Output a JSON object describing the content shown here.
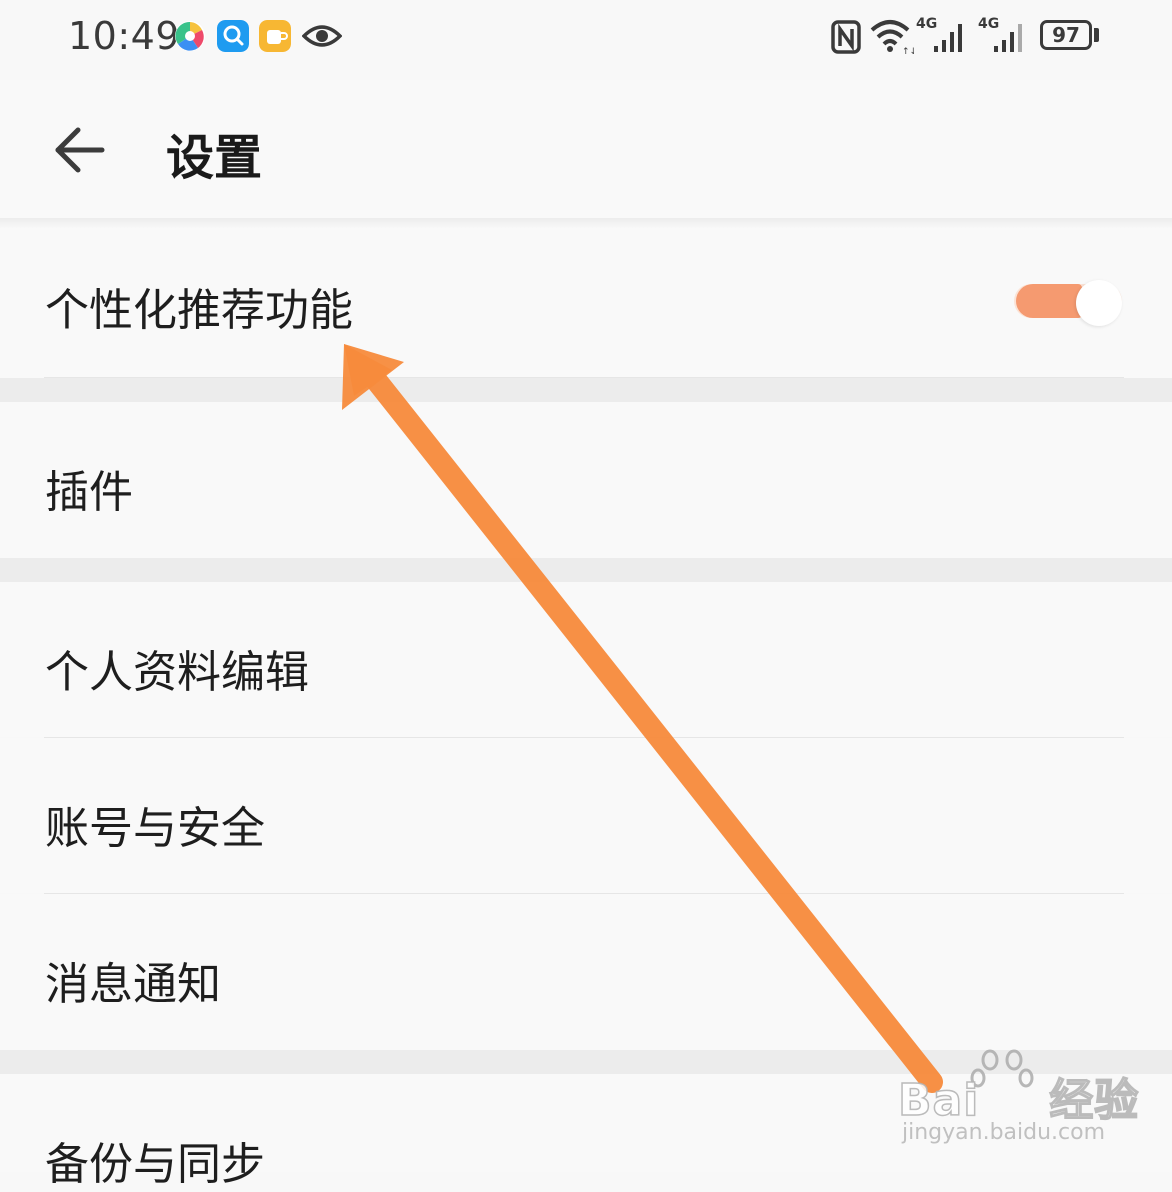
{
  "status_bar": {
    "time": "10:49",
    "left_icons": [
      "pinwheel-app-icon",
      "search-app-icon",
      "cup-app-icon",
      "eye-icon"
    ],
    "right_icons": [
      "nfc-icon",
      "wifi-icon",
      "signal-4g-icon",
      "signal-4g-icon"
    ],
    "network_1": "4G",
    "network_2": "4G",
    "battery": "97"
  },
  "header": {
    "back_icon": "back-arrow-icon",
    "title": "设置"
  },
  "settings": {
    "personalized_recommendation": {
      "label": "个性化推荐功能",
      "toggle_on": true,
      "accent": "#f59a70"
    },
    "plugins": {
      "label": "插件"
    },
    "profile_edit": {
      "label": "个人资料编辑"
    },
    "account_security": {
      "label": "账号与安全"
    },
    "notifications": {
      "label": "消息通知"
    },
    "backup_sync": {
      "label": "备份与同步"
    }
  },
  "annotation": {
    "color": "#f78b3c"
  },
  "watermark": {
    "brand": "Bai",
    "brand_suffix": "经验",
    "url": "jingyan.baidu.com"
  }
}
